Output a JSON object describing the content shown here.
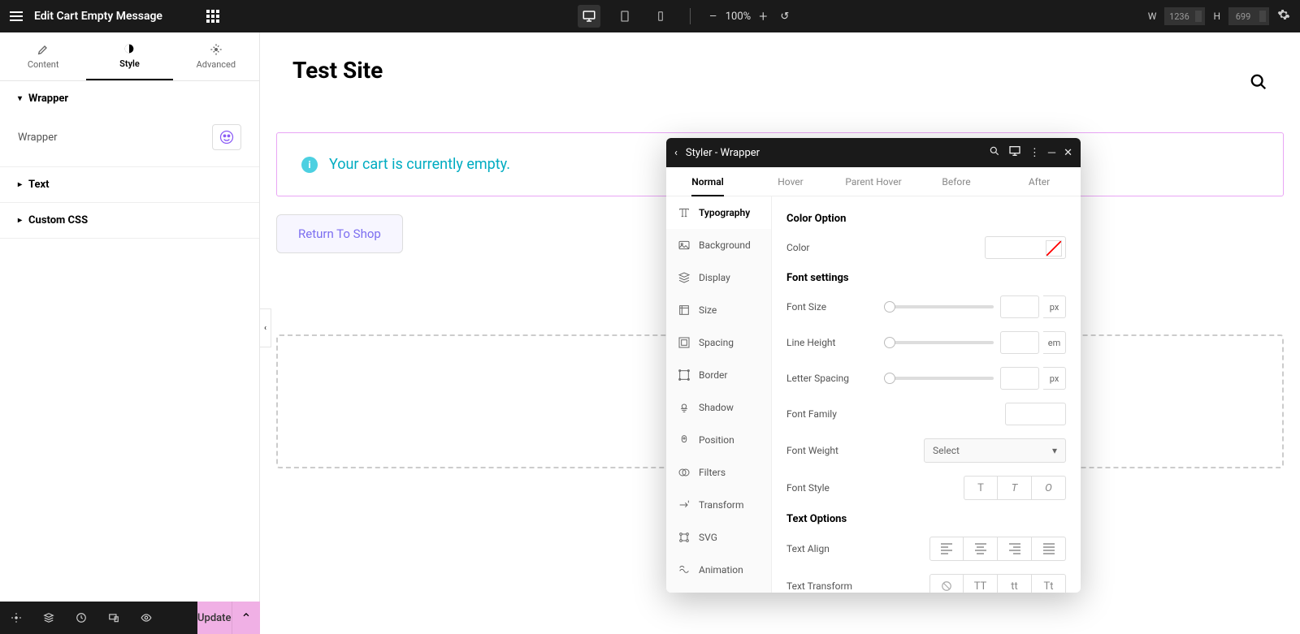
{
  "header": {
    "title": "Edit Cart Empty Message",
    "zoom": "100%",
    "width_label": "W",
    "width_value": "1236",
    "height_label": "H",
    "height_value": "699"
  },
  "sidebar": {
    "tabs": {
      "content": "Content",
      "style": "Style",
      "advanced": "Advanced"
    },
    "sections": {
      "wrapper": {
        "title": "Wrapper",
        "label": "Wrapper"
      },
      "text": {
        "title": "Text"
      },
      "custom_css": {
        "title": "Custom CSS"
      }
    }
  },
  "footer": {
    "update": "Update"
  },
  "canvas": {
    "site_title": "Test Site",
    "cart_message": "Your cart is currently empty.",
    "return_button": "Return To Shop"
  },
  "styler": {
    "title": "Styler - Wrapper",
    "states": {
      "normal": "Normal",
      "hover": "Hover",
      "parent_hover": "Parent Hover",
      "before": "Before",
      "after": "After"
    },
    "categories": {
      "typography": "Typography",
      "background": "Background",
      "display": "Display",
      "size": "Size",
      "spacing": "Spacing",
      "border": "Border",
      "shadow": "Shadow",
      "position": "Position",
      "filters": "Filters",
      "transform": "Transform",
      "svg": "SVG",
      "animation": "Animation"
    },
    "props": {
      "color_option_title": "Color Option",
      "color": "Color",
      "font_settings_title": "Font settings",
      "font_size": "Font Size",
      "line_height": "Line Height",
      "letter_spacing": "Letter Spacing",
      "font_family": "Font Family",
      "font_weight": "Font Weight",
      "font_weight_placeholder": "Select",
      "font_style": "Font Style",
      "text_options_title": "Text Options",
      "text_align": "Text Align",
      "text_transform": "Text Transform",
      "unit_px": "px",
      "unit_em": "em",
      "style_t": "T",
      "style_ti": "T",
      "style_o": "O",
      "tt_upper": "TT",
      "tt_lower": "tt",
      "tt_cap": "Tt"
    }
  }
}
